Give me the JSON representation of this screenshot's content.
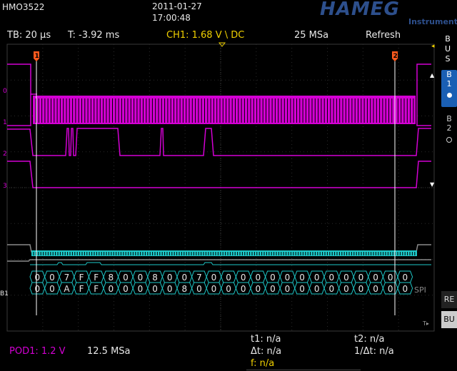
{
  "header": {
    "model": "HMO3522",
    "date": "2011-01-27",
    "time": "17:00:48",
    "brand": "HAMEG",
    "brand_sub": "Instruments"
  },
  "status": {
    "timebase": "TB: 20 µs",
    "trigger_time": "T: -3.92 ms",
    "trigger": "CH1: 1.68 V",
    "trigger_slope_glyph": "\\",
    "trigger_coupling": "DC",
    "sample_rate": "25 MSa",
    "acq_mode": "Refresh"
  },
  "cursors": {
    "c1": "1",
    "c2": "2"
  },
  "channel_markers": [
    "0",
    "1",
    "2",
    "3"
  ],
  "bus": {
    "label": "B1",
    "protocol": "SPI",
    "row1": [
      "0",
      "0",
      "7",
      "F",
      "F",
      "8",
      "0",
      "0",
      "8",
      "0",
      "0",
      "7",
      "0",
      "0",
      "0",
      "0",
      "0",
      "0",
      "0",
      "0",
      "0",
      "0",
      "0",
      "0",
      "0",
      "0"
    ],
    "row2": [
      "0",
      "0",
      "A",
      "F",
      "F",
      "0",
      "0",
      "0",
      "0",
      "0",
      "8",
      "0",
      "0",
      "0",
      "0",
      "0",
      "0",
      "0",
      "0",
      "0",
      "0",
      "0",
      "0",
      "0",
      "0",
      "0"
    ]
  },
  "side_panel": {
    "bus_label": "BUS",
    "b1": "B1",
    "b2": "B2",
    "re": "RE",
    "bu": "BU"
  },
  "bottom": {
    "pod": "POD1: 1.2 V",
    "pod_rate": "12.5 MSa",
    "t1": "t1: n/a",
    "t2": "t2: n/a",
    "dt": "Δt: n/a",
    "inv_dt": "1/Δt: n/a",
    "freq": "f: n/a"
  },
  "colors": {
    "magenta": "#d400d4",
    "cyan": "#1ec8c8",
    "yellow": "#f0d000",
    "orange": "#ff5a1e",
    "blue_tab": "#1a5fb4",
    "brand": "#2d4f8c"
  }
}
